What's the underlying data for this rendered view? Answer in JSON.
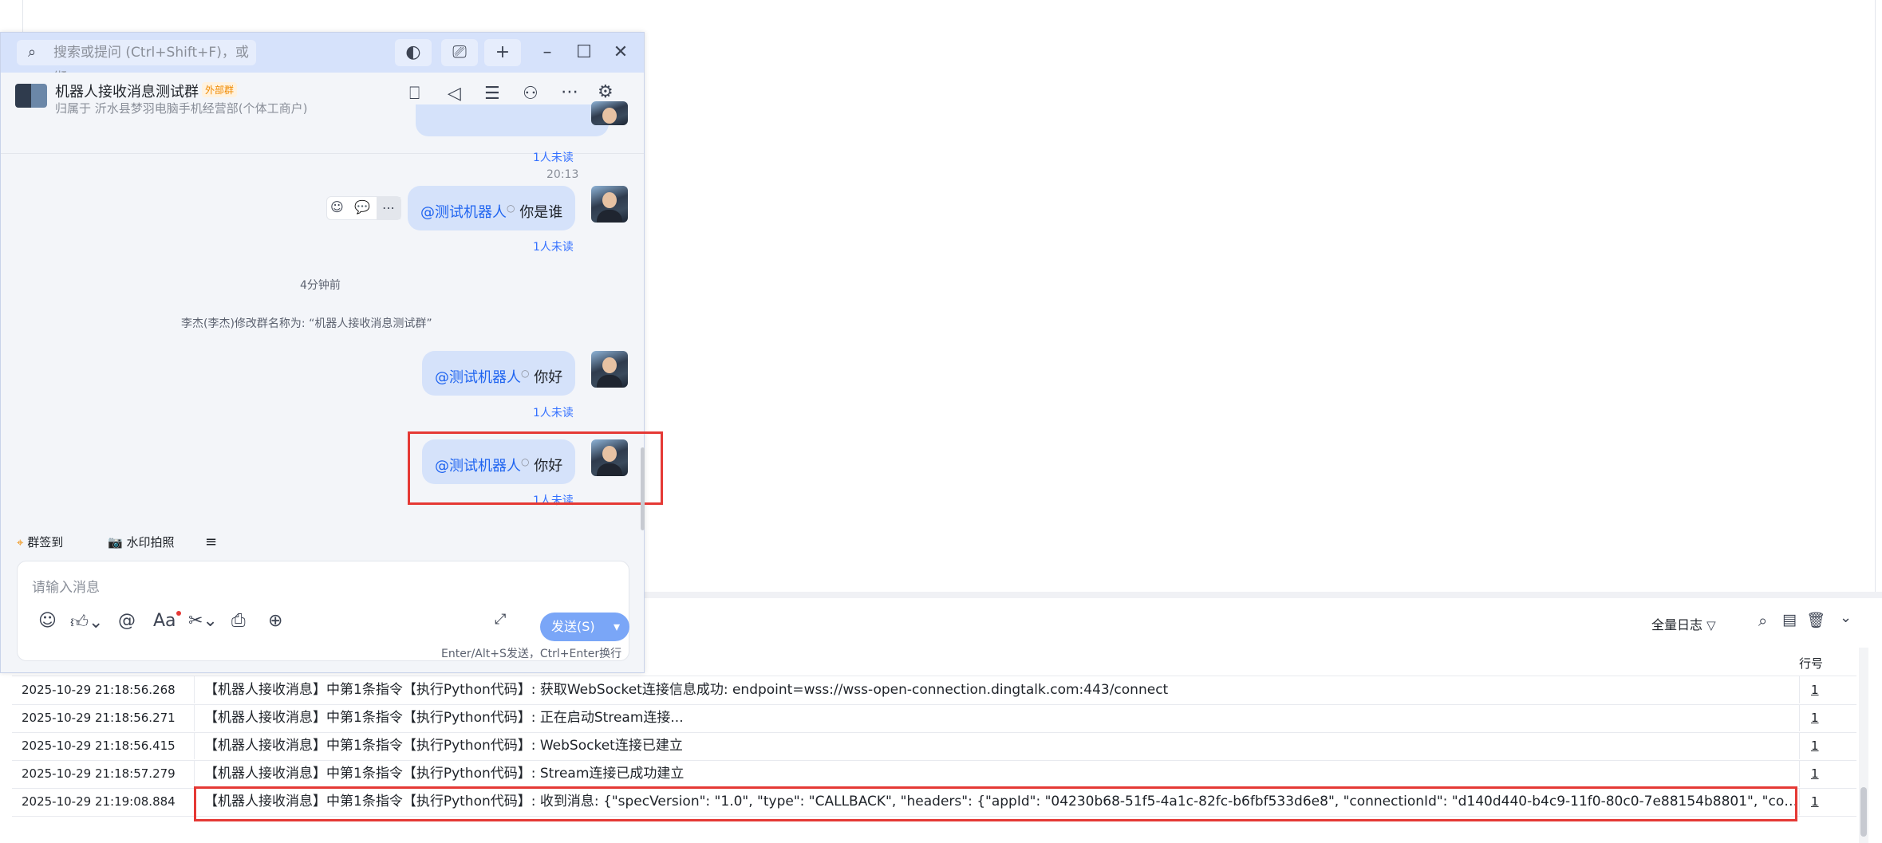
{
  "chat": {
    "search_placeholder": "搜索或提问 (Ctrl+Shift+F)，或缬",
    "group_name": "机器人接收消息测试群",
    "group_badge": "外部群",
    "group_subtitle": "归属于 沂水县梦羽电脑手机经营部(个体工商户)",
    "messages": [
      {
        "mention": "@测试机器人",
        "text": "你是谁",
        "unread": "1人未读"
      },
      {
        "mention": "@测试机器人",
        "text": "你好",
        "unread": "1人未读"
      },
      {
        "mention": "@测试机器人",
        "text": "你好",
        "unread": "1人未读"
      }
    ],
    "top_unread": "1人未读",
    "time_label": "20:13",
    "time_ago": "4分钟前",
    "system_msg": "李杰(李杰)修改群名称为: “机器人接收消息测试群”",
    "shortcut_checkin": "群签到",
    "shortcut_photo": "水印拍照",
    "input_placeholder": "请输入消息",
    "send_label": "发送(S)",
    "send_hint": "Enter/Alt+S发送，Ctrl+Enter换行"
  },
  "log": {
    "filter_label": "全量日志",
    "col_line": "行号",
    "rows": [
      {
        "time": "2025-10-29 21:18:56.268",
        "msg": "【机器人接收消息】中第1条指令【执行Python代码】: 获取WebSocket连接信息成功: endpoint=wss://wss-open-connection.dingtalk.com:443/connect",
        "line": "1"
      },
      {
        "time": "2025-10-29 21:18:56.271",
        "msg": "【机器人接收消息】中第1条指令【执行Python代码】: 正在启动Stream连接...",
        "line": "1"
      },
      {
        "time": "2025-10-29 21:18:56.415",
        "msg": "【机器人接收消息】中第1条指令【执行Python代码】: WebSocket连接已建立",
        "line": "1"
      },
      {
        "time": "2025-10-29 21:18:57.279",
        "msg": "【机器人接收消息】中第1条指令【执行Python代码】: Stream连接已成功建立",
        "line": "1"
      },
      {
        "time": "2025-10-29 21:19:08.884",
        "msg": "【机器人接收消息】中第1条指令【执行Python代码】: 收到消息: {\"specVersion\": \"1.0\", \"type\": \"CALLBACK\", \"headers\": {\"appId\": \"04230b68-51f5-4a1c-82fc-b6fbf533d6e8\", \"connectionId\": \"d140d440-b4c9-11f0-80c0-7e88154b8801\", \"conte...",
        "line": "1"
      }
    ]
  },
  "colors": {
    "accent": "#3370ff",
    "highlight": "#e53935",
    "bubble": "#d5e2fa"
  }
}
